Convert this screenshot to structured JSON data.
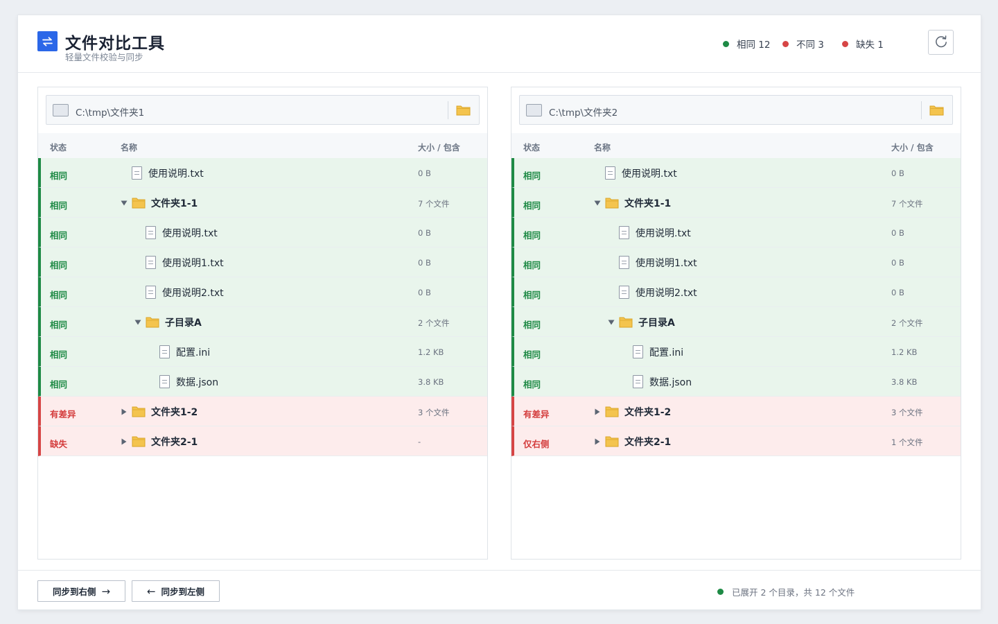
{
  "app": {
    "title": "文件对比工具",
    "subtitle": "轻量文件校验与同步"
  },
  "legend": [
    {
      "label": "相同 12",
      "color": "#1e8a45"
    },
    {
      "label": "不同 3",
      "color": "#d64545"
    },
    {
      "label": "缺失 1",
      "color": "#d64545"
    }
  ],
  "columns": {
    "status": "状态",
    "name": "名称",
    "size": "大小 / 包含"
  },
  "left": {
    "path": "C:\\tmp\\文件夹1",
    "rows": [
      {
        "status": "相同",
        "type": "file",
        "indent": 0,
        "name": "使用说明.txt",
        "size": "0 B",
        "state": "same"
      },
      {
        "status": "相同",
        "type": "folder",
        "expanded": true,
        "indent": 0,
        "name": "文件夹1-1",
        "size": "7 个文件",
        "state": "same"
      },
      {
        "status": "相同",
        "type": "file",
        "indent": 1,
        "name": "使用说明.txt",
        "size": "0 B",
        "state": "same"
      },
      {
        "status": "相同",
        "type": "file",
        "indent": 1,
        "name": "使用说明1.txt",
        "size": "0 B",
        "state": "same"
      },
      {
        "status": "相同",
        "type": "file",
        "indent": 1,
        "name": "使用说明2.txt",
        "size": "0 B",
        "state": "same"
      },
      {
        "status": "相同",
        "type": "folder",
        "expanded": true,
        "indent": 1,
        "name": "子目录A",
        "size": "2 个文件",
        "state": "same"
      },
      {
        "status": "相同",
        "type": "file",
        "indent": 2,
        "name": "配置.ini",
        "size": "1.2 KB",
        "state": "same"
      },
      {
        "status": "相同",
        "type": "file",
        "indent": 2,
        "name": "数据.json",
        "size": "3.8 KB",
        "state": "same"
      },
      {
        "status": "有差异",
        "type": "folder",
        "expanded": false,
        "indent": 0,
        "name": "文件夹1-2",
        "size": "3 个文件",
        "state": "diff"
      },
      {
        "status": "缺失",
        "type": "folder",
        "expanded": false,
        "indent": 0,
        "name": "文件夹2-1",
        "size": "-",
        "state": "diff"
      }
    ]
  },
  "right": {
    "path": "C:\\tmp\\文件夹2",
    "rows": [
      {
        "status": "相同",
        "type": "file",
        "indent": 0,
        "name": "使用说明.txt",
        "size": "0 B",
        "state": "same"
      },
      {
        "status": "相同",
        "type": "folder",
        "expanded": true,
        "indent": 0,
        "name": "文件夹1-1",
        "size": "7 个文件",
        "state": "same"
      },
      {
        "status": "相同",
        "type": "file",
        "indent": 1,
        "name": "使用说明.txt",
        "size": "0 B",
        "state": "same"
      },
      {
        "status": "相同",
        "type": "file",
        "indent": 1,
        "name": "使用说明1.txt",
        "size": "0 B",
        "state": "same"
      },
      {
        "status": "相同",
        "type": "file",
        "indent": 1,
        "name": "使用说明2.txt",
        "size": "0 B",
        "state": "same"
      },
      {
        "status": "相同",
        "type": "folder",
        "expanded": true,
        "indent": 1,
        "name": "子目录A",
        "size": "2 个文件",
        "state": "same"
      },
      {
        "status": "相同",
        "type": "file",
        "indent": 2,
        "name": "配置.ini",
        "size": "1.2 KB",
        "state": "same"
      },
      {
        "status": "相同",
        "type": "file",
        "indent": 2,
        "name": "数据.json",
        "size": "3.8 KB",
        "state": "same"
      },
      {
        "status": "有差异",
        "type": "folder",
        "expanded": false,
        "indent": 0,
        "name": "文件夹1-2",
        "size": "3 个文件",
        "state": "diff"
      },
      {
        "status": "仅右侧",
        "type": "folder",
        "expanded": false,
        "indent": 0,
        "name": "文件夹2-1",
        "size": "1 个文件",
        "state": "diff"
      }
    ]
  },
  "footer": {
    "sync_right": "同步到右侧",
    "sync_left": "同步到左侧",
    "summary": "已展开 2 个目录，共 12 个文件"
  },
  "colors": {
    "accent": "#2b67e8",
    "same": "#1e8a45",
    "diff": "#d64545",
    "folder": "#f4c44e"
  }
}
